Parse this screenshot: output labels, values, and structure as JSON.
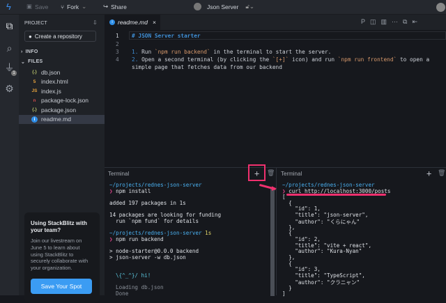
{
  "topbar": {
    "save": "Save",
    "fork": "Fork",
    "share": "Share",
    "project_title": "Json Server"
  },
  "sidebar": {
    "project_label": "PROJECT",
    "create_repo": "Create a repository",
    "info": "INFO",
    "files": "FILES",
    "files_list": [
      {
        "name": "db.json",
        "icon": "{.}",
        "color": "#b5c06a"
      },
      {
        "name": "index.html",
        "icon": "5",
        "color": "#e8a33c"
      },
      {
        "name": "index.js",
        "icon": "JS",
        "color": "#e8a33c"
      },
      {
        "name": "package-lock.json",
        "icon": "n",
        "color": "#d04a4a"
      },
      {
        "name": "package.json",
        "icon": "{.}",
        "color": "#b5c06a"
      },
      {
        "name": "readme.md",
        "icon": "i",
        "color": "#2f8fe8"
      }
    ],
    "badge": "1"
  },
  "promo": {
    "title": "Using StackBlitz with your team?",
    "body": "Join our livestream on June 5 to learn about using StackBlitz to securely collaborate with your organization.",
    "button": "Save Your Spot"
  },
  "editor": {
    "tab": "readme.md",
    "line_numbers": [
      "1",
      "2",
      "3",
      "4"
    ],
    "l1": "# JSON Server starter",
    "l3a": "1.",
    "l3b": " Run ",
    "l3c": "`npm run backend`",
    "l3d": " in the terminal to start the server.",
    "l4a": "2.",
    "l4b": " Open a second terminal (by clicking the ",
    "l4c": "`[+]`",
    "l4d": " icon) and run ",
    "l4e": "`npm run frontend`",
    "l4f": " to open a",
    "l4g": "simple page that fetches data from our backend"
  },
  "terminal_left": {
    "title": "Terminal",
    "lines": [
      "~/projects/rednes-json-server",
      "❯",
      "npm install",
      "added 197 packages in 1s",
      "14 packages are looking for funding",
      "  run `npm fund` for details",
      "~/projects/rednes-json-server",
      "1s",
      "❯",
      "npm run backend",
      "> node-starter@0.0.0 backend",
      "> json-server -w db.json",
      "\\{^_^}/ hi!",
      "Loading db.json",
      "Done"
    ]
  },
  "terminal_right": {
    "title": "Terminal",
    "prompt": "~/projects/rednes-json-server",
    "arrow": "❯",
    "command": "curl http://localhost:3000/posts",
    "output": [
      "[",
      "  {",
      "    \"id\": 1,",
      "    \"title\": \"json-server\",",
      "    \"author\": \"くらにゃん\"",
      "  },",
      "  {",
      "    \"id\": 2,",
      "    \"title\": \"vite + react\",",
      "    \"author\": \"Kura-Nyan\"",
      "  },",
      "  {",
      "    \"id\": 3,",
      "    \"title\": \"TypeScript\",",
      "    \"author\": \"クラニャン\"",
      "  }",
      "]"
    ]
  }
}
